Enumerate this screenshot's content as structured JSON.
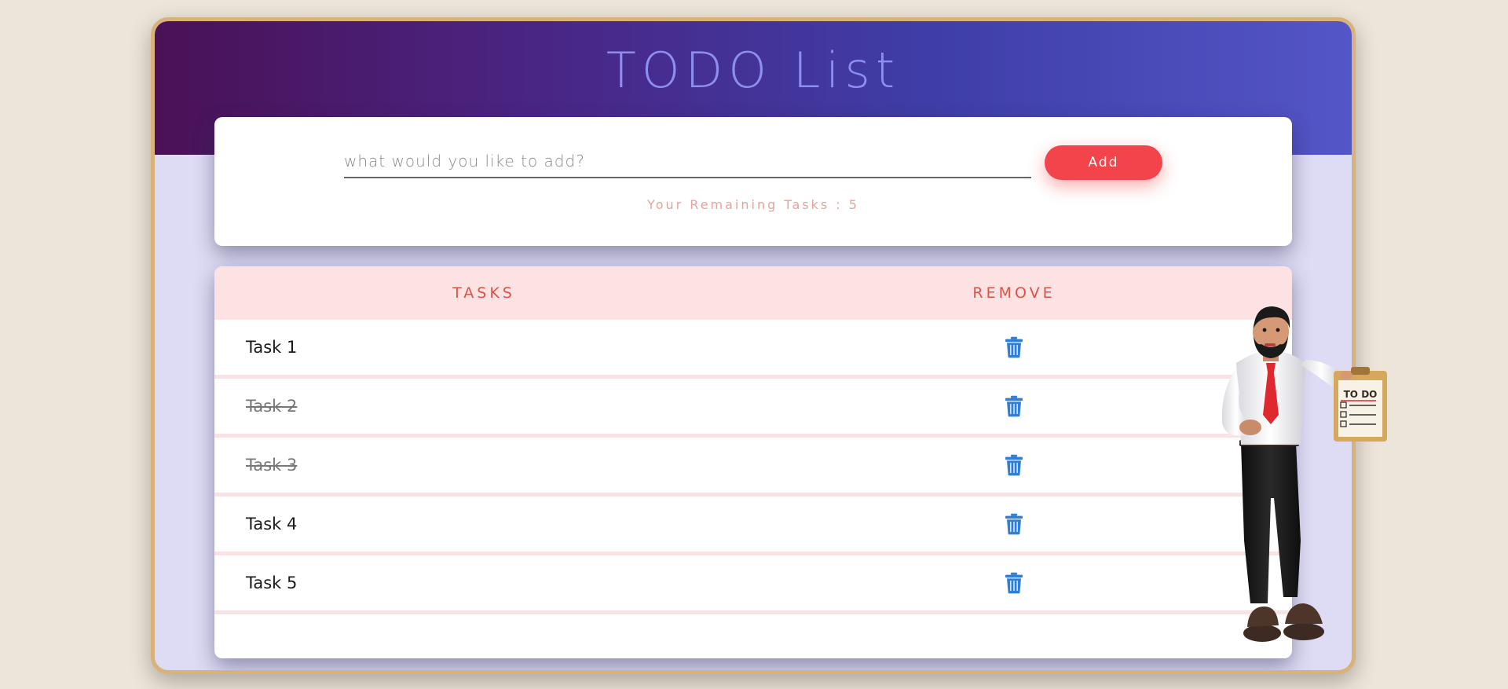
{
  "app": {
    "title": "TODO List"
  },
  "input": {
    "placeholder": "what would you like to add?",
    "value": ""
  },
  "add_button": {
    "label": "Add"
  },
  "remaining": {
    "text": "Your Remaining Tasks : 5"
  },
  "table": {
    "headers": {
      "tasks": "TASKS",
      "remove": "REMOVE"
    },
    "rows": [
      {
        "label": "Task 1",
        "completed": false
      },
      {
        "label": "Task 2",
        "completed": true
      },
      {
        "label": "Task 3",
        "completed": true
      },
      {
        "label": "Task 4",
        "completed": false
      },
      {
        "label": "Task 5",
        "completed": false
      }
    ]
  },
  "icons": {
    "remove": "trash-icon",
    "illustration": "person-with-clipboard-illustration"
  },
  "illustration_clipboard_text": "TO DO",
  "colors": {
    "background": "#ede5d9",
    "frame_border": "#d9b27a",
    "accent": "#f2444a",
    "header_text": "#d9534a",
    "trash_blue": "#2f7fd6"
  }
}
